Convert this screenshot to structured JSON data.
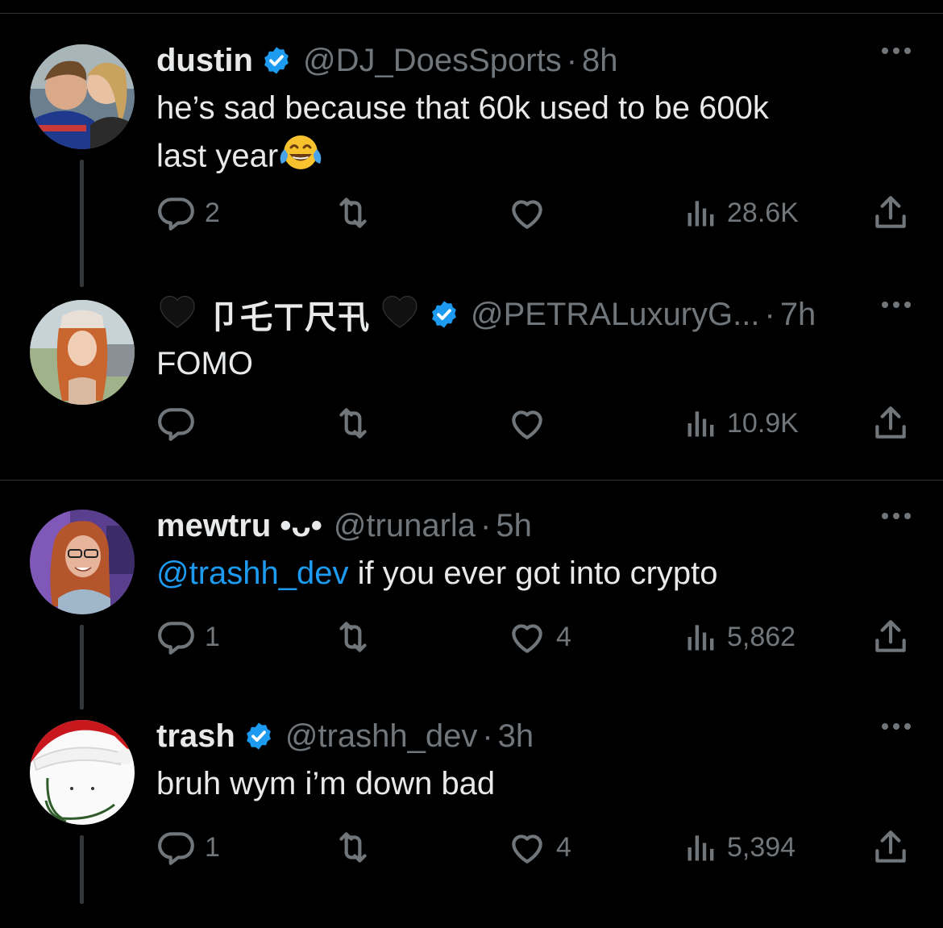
{
  "tweets": [
    {
      "name": "dustin",
      "verified": true,
      "handle": "@DJ_DoesSports",
      "sep": "·",
      "time": "8h",
      "text": "he’s sad because that 60k used to be 600k last year",
      "text_line1": "he’s sad because that 60k used to be 600k",
      "text_line2": "last year",
      "emoji": "face-with-tears-of-joy",
      "stats": {
        "replies": "2",
        "retweets": "",
        "likes": "",
        "views": "28.6K"
      }
    },
    {
      "name_prefix": "🖤",
      "name_styled": "卩乇ㄒ尺卂",
      "name_suffix": "🖤",
      "verified": true,
      "handle": "@PETRALuxuryG...",
      "sep": "·",
      "time": "7h",
      "text": "FOMO",
      "stats": {
        "replies": "",
        "retweets": "",
        "likes": "",
        "views": "10.9K"
      }
    },
    {
      "name": "mewtru •ᴗ•",
      "verified": false,
      "handle": "@trunarla",
      "sep": "·",
      "time": "5h",
      "mention": "@trashh_dev",
      "text": " if you ever got into crypto",
      "stats": {
        "replies": "1",
        "retweets": "",
        "likes": "4",
        "views": "5,862"
      }
    },
    {
      "name": "trash",
      "verified": true,
      "handle": "@trashh_dev",
      "sep": "·",
      "time": "3h",
      "text": "bruh wym i’m down bad",
      "stats": {
        "replies": "1",
        "retweets": "",
        "likes": "4",
        "views": "5,394"
      }
    }
  ],
  "icons": {
    "reply": "reply-icon",
    "retweet": "retweet-icon",
    "like": "like-icon",
    "views": "views-icon",
    "share": "share-icon",
    "more": "more-icon",
    "verified": "verified-badge-icon"
  },
  "colors": {
    "background": "#000000",
    "text": "#e7e9ea",
    "muted": "#71767b",
    "accent": "#1d9bf0",
    "divider": "#2f3336"
  }
}
